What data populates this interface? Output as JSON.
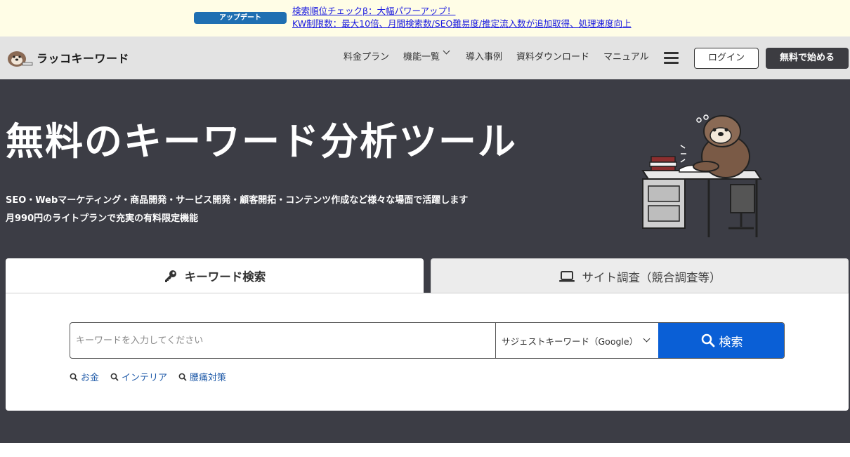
{
  "announce": {
    "badge": "アップデート",
    "line1": "検索順位チェックβ：大幅パワーアップ！",
    "line2": "KW制限数：最大10倍、月間検索数/SEO難易度/推定流入数が追加取得、処理速度向上"
  },
  "header": {
    "logo_text": "ラッコキーワード",
    "nav": [
      "料金プラン",
      "機能一覧",
      "導入事例",
      "資料ダウンロード",
      "マニュアル"
    ],
    "login": "ログイン",
    "start": "無料で始める"
  },
  "hero": {
    "title": "無料のキーワード分析ツール",
    "sub1": "SEO・Webマーケティング・商品開発・サービス開発・顧客開拓・コンテンツ作成など様々な場面で活躍します",
    "sub2": "月990円のライトプランで充実の有料限定機能"
  },
  "tabs": {
    "keyword": "キーワード検索",
    "site": "サイト調査（競合調査等）"
  },
  "search": {
    "placeholder": "キーワードを入力してください",
    "select_value": "サジェストキーワード（Google）",
    "button": "検索"
  },
  "suggestions": [
    "お金",
    "インテリア",
    "腰痛対策"
  ],
  "colors": {
    "announce_bg": "#fffde6",
    "hero_bg": "#3c3d45",
    "search_button": "#0a5fd6",
    "link": "#1a1ae0"
  }
}
